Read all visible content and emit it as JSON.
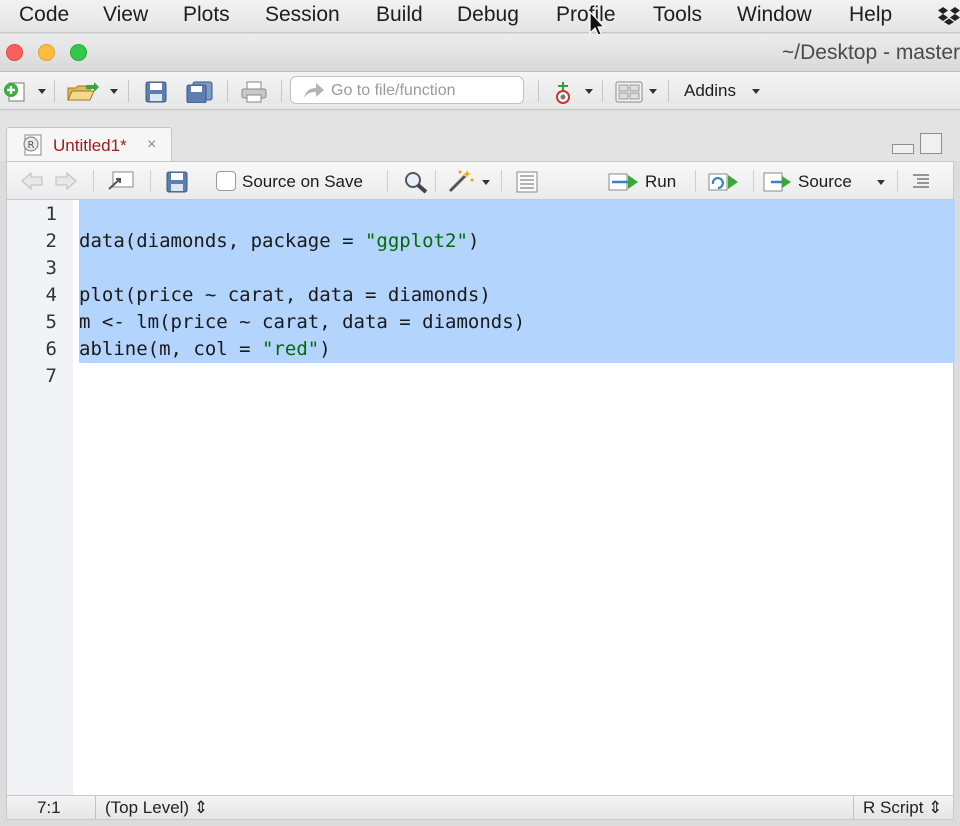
{
  "menubar": {
    "items": [
      "Code",
      "View",
      "Plots",
      "Session",
      "Build",
      "Debug",
      "Profile",
      "Tools",
      "Window",
      "Help"
    ]
  },
  "window": {
    "title": "~/Desktop - master"
  },
  "toolbar": {
    "goto_placeholder": "Go to file/function",
    "addins_label": "Addins"
  },
  "editor_tab": {
    "label": "Untitled1*",
    "close": "×"
  },
  "editor_toolbar": {
    "source_on_save": "Source on Save",
    "run_label": "Run",
    "source_label": "Source"
  },
  "editor": {
    "line_numbers": [
      "1",
      "2",
      "3",
      "4",
      "5",
      "6",
      "7"
    ],
    "lines": [
      {
        "code": "",
        "string": "",
        "tail": ""
      },
      {
        "code": "data(diamonds, package = ",
        "string": "\"ggplot2\"",
        "tail": ")"
      },
      {
        "code": "",
        "string": "",
        "tail": ""
      },
      {
        "code": "plot(price ~ carat, data = diamonds)",
        "string": "",
        "tail": ""
      },
      {
        "code": "m <- lm(price ~ carat, data = diamonds)",
        "string": "",
        "tail": ""
      },
      {
        "code": "abline(m, col = ",
        "string": "\"red\"",
        "tail": ")"
      },
      {
        "code": "",
        "string": "",
        "tail": ""
      }
    ]
  },
  "statusbar": {
    "position": "7:1",
    "scope": "(Top Level) ⇕",
    "file_type": "R Script ⇕"
  },
  "colors": {
    "selection": "#b3d4fc",
    "string": "#036a07",
    "tab_label": "#9b1c1c"
  }
}
